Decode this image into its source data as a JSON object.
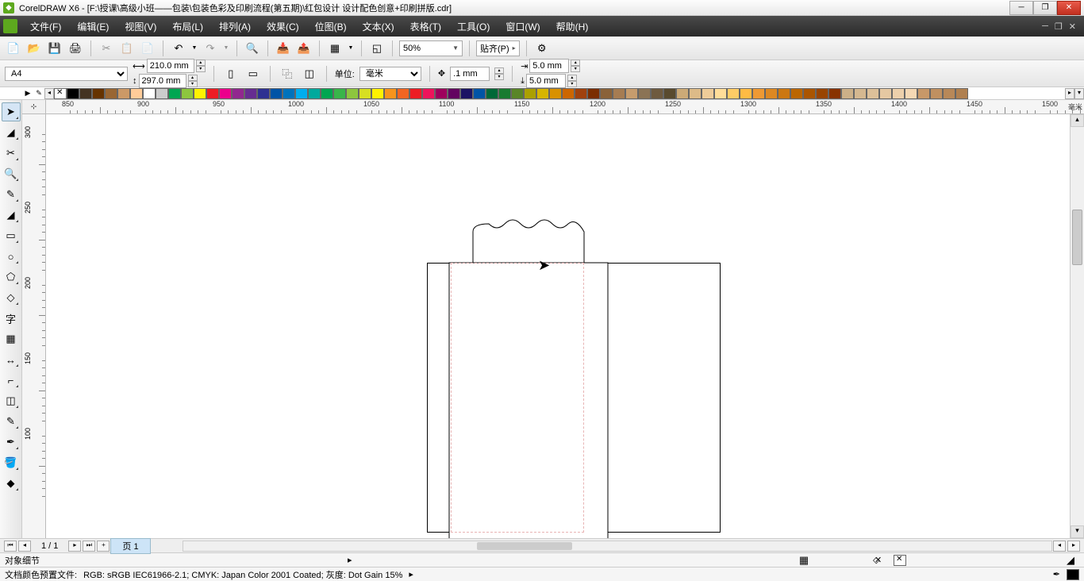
{
  "app": {
    "name": "CorelDRAW X6",
    "file_path": "[F:\\授课\\高级小班——包装\\包装色彩及印刷流程(第五期)\\红包设计 设计配色创意+印刷拼版.cdr]"
  },
  "menu": {
    "file": "文件(F)",
    "edit": "编辑(E)",
    "view": "视图(V)",
    "layout": "布局(L)",
    "arrange": "排列(A)",
    "effects": "效果(C)",
    "bitmap": "位图(B)",
    "text": "文本(X)",
    "table": "表格(T)",
    "tools": "工具(O)",
    "window": "窗口(W)",
    "help": "帮助(H)"
  },
  "toolbar1": {
    "zoom": "50%",
    "snap": "贴齐(P)"
  },
  "property_bar": {
    "page_size": "A4",
    "width": "210.0 mm",
    "height": "297.0 mm",
    "unit_label": "单位:",
    "unit": "毫米",
    "nudge": ".1 mm",
    "dup_x": "5.0 mm",
    "dup_y": "5.0 mm"
  },
  "ruler": {
    "unit": "毫米",
    "h_ticks": [
      "850",
      "900",
      "950",
      "1000",
      "1050",
      "1100",
      "1150",
      "1200",
      "1250",
      "1300",
      "1350",
      "1400",
      "1450",
      "1500"
    ],
    "v_ticks": [
      "300",
      "250",
      "200",
      "150",
      "100"
    ]
  },
  "palette": {
    "colors": [
      "#000000",
      "#443322",
      "#663300",
      "#996633",
      "#cc9966",
      "#ffcc99",
      "#ffffff",
      "#cccccc",
      "#00a651",
      "#8dc63e",
      "#fff200",
      "#ed1c24",
      "#ec008c",
      "#92278f",
      "#662d91",
      "#2e3192",
      "#0054a6",
      "#0072bc",
      "#00aeef",
      "#00a99d",
      "#00a651",
      "#39b54a",
      "#8dc63e",
      "#d7df23",
      "#fff200",
      "#f7941d",
      "#f26522",
      "#ed1c24",
      "#ed145b",
      "#9e005d",
      "#630460",
      "#1b1464",
      "#0054a6",
      "#006838",
      "#197b30",
      "#598527",
      "#aba000",
      "#d7b500",
      "#d99100",
      "#cc6600",
      "#a0410d",
      "#7b2e00",
      "#8a6239",
      "#a67c52",
      "#c69c6d",
      "#8b7355",
      "#6e5a3f",
      "#594a2e",
      "#ccaa77",
      "#ddbb88",
      "#eecc99",
      "#ffdd99",
      "#ffcc66",
      "#ffbb44",
      "#ee9933",
      "#dd8822",
      "#cc7711",
      "#bb6600",
      "#aa5500",
      "#994400",
      "#883300",
      "#ccb088",
      "#d5b890",
      "#ddc099",
      "#e5c8a2",
      "#edd0ab",
      "#f5d8b4",
      "#c89868",
      "#c09060",
      "#b88858",
      "#b08050"
    ]
  },
  "page_tabs": {
    "count": "1 / 1",
    "tab1": "页 1"
  },
  "status1": {
    "detail": "对象细节"
  },
  "status2": {
    "profile_label": "文档颜色预置文件:",
    "profile": "RGB: sRGB IEC61966-2.1; CMYK: Japan Color 2001 Coated; 灰度: Dot Gain 15%"
  }
}
